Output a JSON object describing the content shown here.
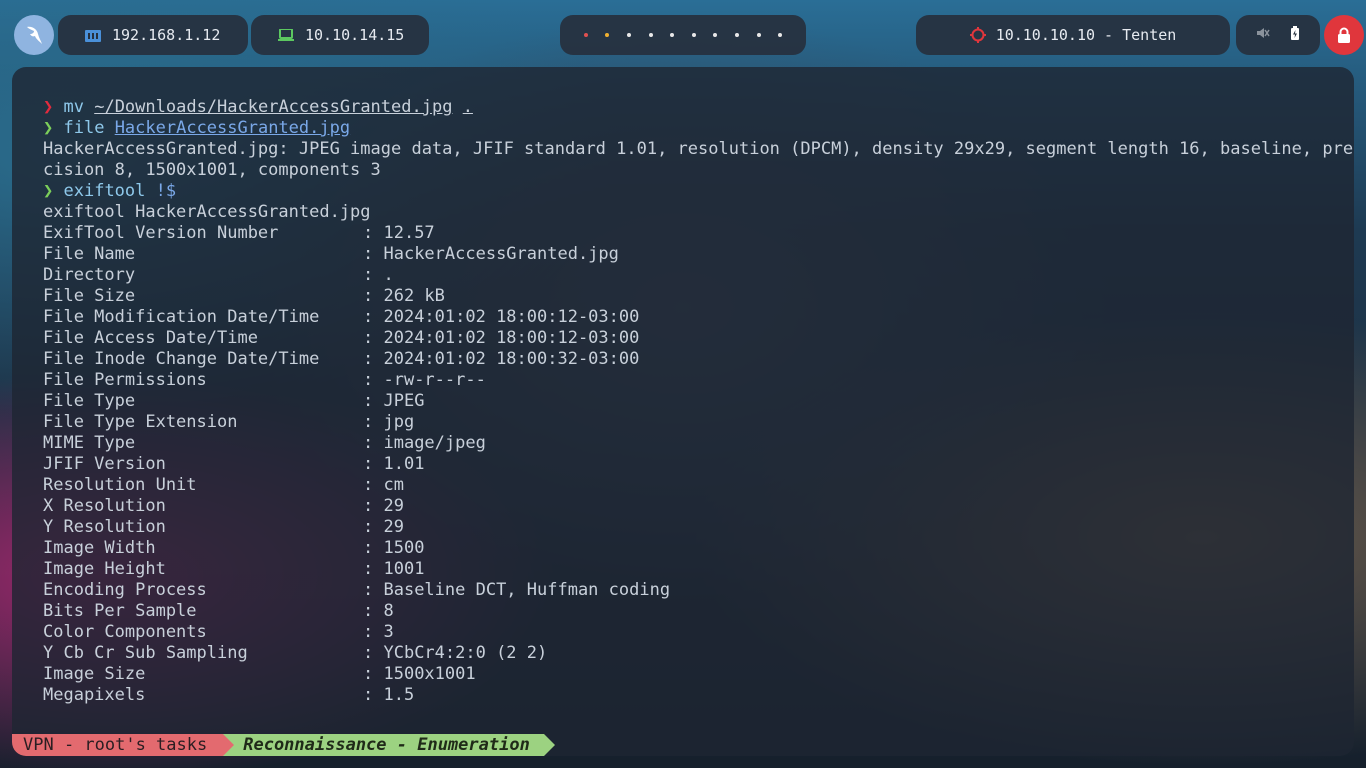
{
  "topbar": {
    "host_ip": "192.168.1.12",
    "vpn_ip": "10.10.14.15",
    "target": "10.10.10.10 - Tenten",
    "workspace_dots": [
      "red",
      "yellow",
      "white",
      "white",
      "white",
      "white",
      "white",
      "white",
      "white",
      "white"
    ]
  },
  "terminal": {
    "lines": [
      {
        "type": "cmd",
        "prompt": "err",
        "parts": [
          {
            "t": "mv ",
            "c": "cmd"
          },
          {
            "t": "~/Downloads/HackerAccessGranted.jpg",
            "c": "u"
          },
          {
            "t": " ",
            "c": ""
          },
          {
            "t": ".",
            "c": "u"
          }
        ]
      },
      {
        "type": "cmd",
        "prompt": "ok",
        "parts": [
          {
            "t": "file ",
            "c": "cmd"
          },
          {
            "t": "HackerAccessGranted.jpg",
            "c": "arg-link"
          }
        ]
      },
      {
        "type": "out",
        "text": "HackerAccessGranted.jpg: JPEG image data, JFIF standard 1.01, resolution (DPCM), density 29x29, segment length 16, baseline, pre"
      },
      {
        "type": "out",
        "text": "cision 8, 1500x1001, components 3"
      },
      {
        "type": "cmd",
        "prompt": "ok",
        "parts": [
          {
            "t": "exiftool ",
            "c": "cmd"
          },
          {
            "t": "!$",
            "c": "bang"
          }
        ]
      },
      {
        "type": "out",
        "text": "exiftool HackerAccessGranted.jpg"
      }
    ],
    "exif": [
      [
        "ExifTool Version Number",
        "12.57"
      ],
      [
        "File Name",
        "HackerAccessGranted.jpg"
      ],
      [
        "Directory",
        "."
      ],
      [
        "File Size",
        "262 kB"
      ],
      [
        "File Modification Date/Time",
        "2024:01:02 18:00:12-03:00"
      ],
      [
        "File Access Date/Time",
        "2024:01:02 18:00:12-03:00"
      ],
      [
        "File Inode Change Date/Time",
        "2024:01:02 18:00:32-03:00"
      ],
      [
        "File Permissions",
        "-rw-r--r--"
      ],
      [
        "File Type",
        "JPEG"
      ],
      [
        "File Type Extension",
        "jpg"
      ],
      [
        "MIME Type",
        "image/jpeg"
      ],
      [
        "JFIF Version",
        "1.01"
      ],
      [
        "Resolution Unit",
        "cm"
      ],
      [
        "X Resolution",
        "29"
      ],
      [
        "Y Resolution",
        "29"
      ],
      [
        "Image Width",
        "1500"
      ],
      [
        "Image Height",
        "1001"
      ],
      [
        "Encoding Process",
        "Baseline DCT, Huffman coding"
      ],
      [
        "Bits Per Sample",
        "8"
      ],
      [
        "Color Components",
        "3"
      ],
      [
        "Y Cb Cr Sub Sampling",
        "YCbCr4:2:0 (2 2)"
      ],
      [
        "Image Size",
        "1500x1001"
      ],
      [
        "Megapixels",
        "1.5"
      ]
    ],
    "prompt_char": "❯",
    "separator": ": "
  },
  "statusbar": {
    "session": "VPN - root's tasks",
    "window": "Reconnaissance - Enumeration"
  },
  "colors": {
    "prompt_error": "#e22b3e",
    "prompt_ok": "#7ccf5a",
    "session_bg": "#e36a6f",
    "window_bg": "#9cd281",
    "lock_bg": "#e0363c"
  }
}
